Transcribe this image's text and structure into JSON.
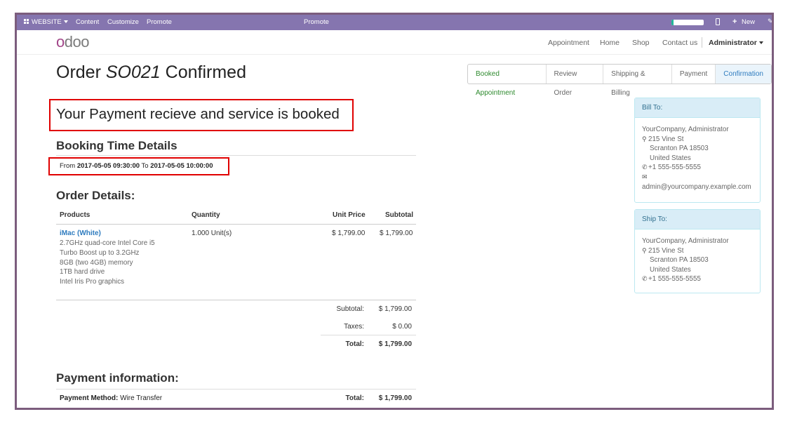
{
  "adminbar": {
    "website_label": "WEBSITE",
    "menu": [
      "Content",
      "Customize",
      "Promote"
    ],
    "center_label": "Promote",
    "new_label": "New"
  },
  "navbar": {
    "logo": "odoo",
    "links": [
      "Appointment",
      "Home",
      "Shop",
      "Contact us"
    ],
    "user": "Administrator"
  },
  "page": {
    "title_prefix": "Order ",
    "order_ref": "SO021",
    "title_suffix": " Confirmed"
  },
  "wizard": {
    "steps": [
      "Booked Appointment",
      "Review Order",
      "Shipping & Billing",
      "Payment",
      "Confirmation"
    ],
    "active": "Confirmation"
  },
  "message": "Your Payment recieve and service is booked",
  "booking": {
    "heading": "Booking Time Details",
    "from_label": "From",
    "from": "2017-05-05 09:30:00",
    "to_label": "To",
    "to": "2017-05-05 10:00:00"
  },
  "order": {
    "heading": "Order Details:",
    "columns": [
      "Products",
      "Quantity",
      "Unit Price",
      "Subtotal"
    ],
    "line": {
      "product": "iMac (White)",
      "description": [
        "2.7GHz quad-core Intel Core i5",
        "Turbo Boost up to 3.2GHz",
        "8GB (two 4GB) memory",
        "1TB hard drive",
        "Intel Iris Pro graphics"
      ],
      "quantity": "1.000 Unit(s)",
      "unit_price": "$ 1,799.00",
      "subtotal": "$ 1,799.00"
    },
    "totals": {
      "subtotal_label": "Subtotal:",
      "subtotal": "$ 1,799.00",
      "taxes_label": "Taxes:",
      "taxes": "$ 0.00",
      "total_label": "Total:",
      "total": "$ 1,799.00"
    }
  },
  "payment": {
    "heading": "Payment information:",
    "method_label": "Payment Method:",
    "method": "Wire Transfer",
    "total_label": "Total:",
    "total": "$ 1,799.00"
  },
  "bill_to": {
    "title": "Bill To:",
    "name": "YourCompany, Administrator",
    "street": "215 Vine St",
    "city": "Scranton PA 18503",
    "country": "United States",
    "phone": "+1 555-555-5555",
    "email": "admin@yourcompany.example.com"
  },
  "ship_to": {
    "title": "Ship To:",
    "name": "YourCompany, Administrator",
    "street": "215 Vine St",
    "city": "Scranton PA 18503",
    "country": "United States",
    "phone": "+1 555-555-5555"
  },
  "colors": {
    "adminbar": "#8575af",
    "frame": "#7c5d7d",
    "link": "#2f7cbf",
    "highlight": "#e00000",
    "panel_head": "#d9edf7"
  }
}
